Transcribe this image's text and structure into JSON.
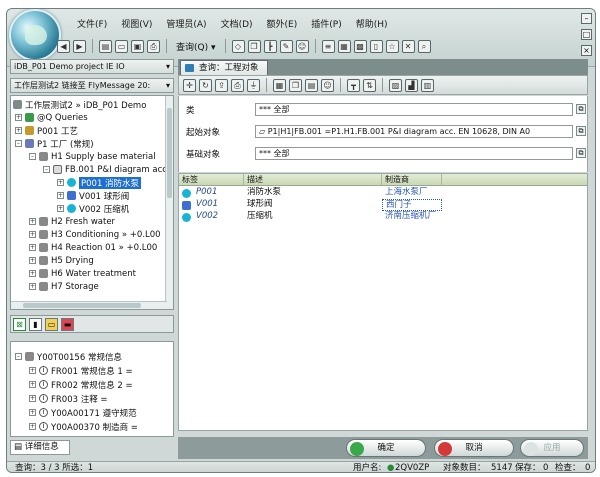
{
  "menu": [
    "文件(F)",
    "视图(V)",
    "管理员(A)",
    "文档(D)",
    "额外(E)",
    "插件(P)",
    "帮助(H)"
  ],
  "toolbar": {
    "query_label": "查询(Q)"
  },
  "left": {
    "project_title": "iDB_P01  Demo project IE IO",
    "layer_title": "工作层测试2  链接至 FlyMessage 20:",
    "tree": [
      {
        "label": "工作层测试2  »  iDB_P01  Demo"
      },
      {
        "label": "@Q  Queries"
      },
      {
        "label": "P001  工艺"
      },
      {
        "label": "P1  工厂 (常规)"
      },
      {
        "label": "H1  Supply base material"
      },
      {
        "label": "FB.001  P&I diagram acc"
      },
      {
        "label": "P001  消防水泵"
      },
      {
        "label": "V001  球形阀"
      },
      {
        "label": "V002  压缩机"
      },
      {
        "label": "H2  Fresh water"
      },
      {
        "label": "H3  Conditioning  »  +0.L00"
      },
      {
        "label": "H4  Reaction 01  »  +0.L00"
      },
      {
        "label": "H5  Drying"
      },
      {
        "label": "H6  Water treatment"
      },
      {
        "label": "H7  Storage"
      }
    ],
    "detail_tree": [
      {
        "label": "Y00T00156  常规信息"
      },
      {
        "label": "FR001  常规信息 1 ="
      },
      {
        "label": "FR002  常规信息 2 ="
      },
      {
        "label": "FR003  注释 ="
      },
      {
        "label": "Y00A00171  遵守规范"
      },
      {
        "label": "Y00A00370  制造商 ="
      }
    ],
    "detail_tab": "详细信息"
  },
  "right": {
    "tab_title": "查询：工程对象",
    "fields": [
      {
        "label": "类",
        "value": "*** 全部"
      },
      {
        "label": "起始对象",
        "value": "P1|H1|FB.001   =P1.H1.FB.001    P&I diagram acc. EN 10628, DIN A0"
      },
      {
        "label": "基础对象",
        "value": "*** 全部"
      }
    ],
    "columns": [
      "标签",
      "描述",
      "制造商"
    ],
    "rows": [
      {
        "tag": "P001",
        "desc": "消防水泵",
        "maker": "上海水泵厂"
      },
      {
        "tag": "V001",
        "desc": "球形阀",
        "maker": "西门子"
      },
      {
        "tag": "V002",
        "desc": "压缩机",
        "maker": "济南压缩机厂"
      }
    ]
  },
  "buttons": {
    "ok": "确定",
    "cancel": "取消",
    "apply": "应用"
  },
  "status": {
    "left": "查询：3 / 3  所选：1",
    "user_label": "用户名:",
    "user": "2QV0ZP",
    "count_label": "对象数目：",
    "count": "5147",
    "save_label": "保存：",
    "save": "0",
    "check_label": "检查：",
    "check": "0"
  },
  "colors": {
    "accent": "#1f6fd0",
    "link": "#2956b2",
    "grid_header": "#d5e2c4"
  }
}
